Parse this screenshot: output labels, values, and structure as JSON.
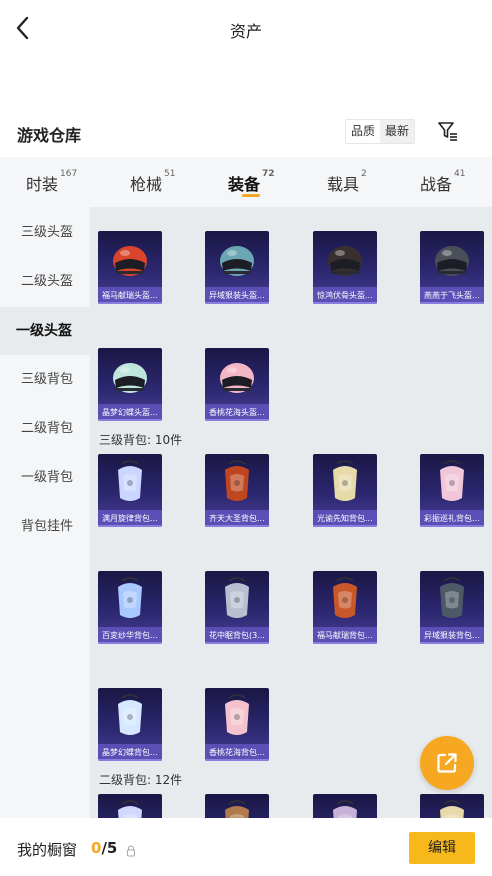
{
  "header": {
    "title": "资产"
  },
  "section": {
    "title": "游戏仓库",
    "sort_options": [
      "品质",
      "最新"
    ]
  },
  "tabs": [
    {
      "label": "时装",
      "count": "167"
    },
    {
      "label": "枪械",
      "count": "51"
    },
    {
      "label": "装备",
      "count": "72"
    },
    {
      "label": "载具",
      "count": "2"
    },
    {
      "label": "战备",
      "count": "41"
    }
  ],
  "sidebar": {
    "items": [
      "三级头盔",
      "二级头盔",
      "一级头盔",
      "三级背包",
      "二级背包",
      "一级背包",
      "背包挂件"
    ],
    "active_index": 2
  },
  "groups": [
    {
      "label": "",
      "items": [
        {
          "name": "福马献瑞头盔...",
          "kind": "helmet",
          "color": "#d9452b"
        },
        {
          "name": "异域狠装头盔...",
          "kind": "helmet",
          "color": "#6aa7b3"
        },
        {
          "name": "惊鸿伏骨头盔...",
          "kind": "helmet",
          "color": "#3a2f2f"
        },
        {
          "name": "燕燕于飞头盔...",
          "kind": "helmet",
          "color": "#4a4e58"
        },
        {
          "name": "晶梦幻蝶头盔...",
          "kind": "helmet",
          "color": "#bfe6dc"
        },
        {
          "name": "香桃花海头盔...",
          "kind": "helmet",
          "color": "#f3b6c4"
        }
      ]
    },
    {
      "label": "三级背包: 10件",
      "items": [
        {
          "name": "满月旋律背包...",
          "kind": "pack",
          "color": "#c9d6ff"
        },
        {
          "name": "齐天大圣背包...",
          "kind": "pack",
          "color": "#c0461f"
        },
        {
          "name": "光谕先知背包...",
          "kind": "pack",
          "color": "#e8d9a8"
        },
        {
          "name": "彩振巡礼背包...",
          "kind": "pack",
          "color": "#f0c6d8"
        },
        {
          "name": "百変纱华背包...",
          "kind": "pack",
          "color": "#a8c8ff"
        },
        {
          "name": "花中眠背包(3...",
          "kind": "pack",
          "color": "#b8c0d0"
        },
        {
          "name": "福马献瑞背包...",
          "kind": "pack",
          "color": "#c8582a"
        },
        {
          "name": "异域狠装背包...",
          "kind": "pack",
          "color": "#4d5a66"
        },
        {
          "name": "晶梦幻蝶背包...",
          "kind": "pack",
          "color": "#d6e8ff"
        },
        {
          "name": "香桃花海背包...",
          "kind": "pack",
          "color": "#f4c2cc"
        }
      ]
    },
    {
      "label": "二级背包: 12件",
      "items": [
        {
          "name": "",
          "kind": "pack",
          "color": "#d0d8ff"
        },
        {
          "name": "",
          "kind": "pack",
          "color": "#b07a4a"
        },
        {
          "name": "",
          "kind": "pack",
          "color": "#c6b2d8"
        },
        {
          "name": "",
          "kind": "pack",
          "color": "#e8d9a8"
        }
      ]
    }
  ],
  "footer": {
    "label": "我的橱窗",
    "current": "0",
    "total": "/5",
    "edit_label": "编辑"
  }
}
